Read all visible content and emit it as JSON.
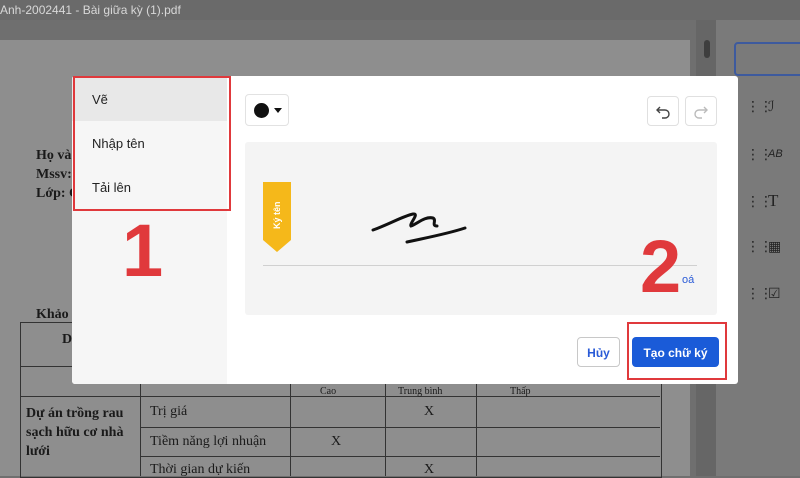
{
  "window": {
    "title": "Anh-2002441 - Bài giữa kỳ (1).pdf"
  },
  "document": {
    "info_lines": [
      "Họ và",
      "Mssv:",
      "Lớp: C"
    ],
    "section_label": "Khảo",
    "table": {
      "header_first": "D",
      "header_cols": [
        "Cao",
        "Trung bình",
        "Thấp"
      ],
      "row_group": "Dự án trồng rau sạch hữu cơ nhà lưới",
      "rows": [
        {
          "criterion": "Trị giá",
          "mark": "X",
          "col": 1
        },
        {
          "criterion": "Tiềm năng lợi nhuận",
          "mark": "X",
          "col": 0
        },
        {
          "criterion": "Thời gian dự kiến",
          "mark": "X",
          "col": 1
        }
      ]
    }
  },
  "right_panel": {
    "icons": [
      "signature-icon",
      "initials-icon",
      "text-icon",
      "calendar-icon",
      "checkbox-icon"
    ],
    "labels": [
      "ℐ",
      "AB",
      "T",
      "▦",
      "☑"
    ]
  },
  "modal": {
    "tabs": [
      {
        "label": "Vẽ",
        "active": true
      },
      {
        "label": "Nhập tên",
        "active": false
      },
      {
        "label": "Tải lên",
        "active": false
      }
    ],
    "pen_color": "#111111",
    "sign_tag_label": "Ký tên",
    "clear_label": "oá",
    "cancel_label": "Hủy",
    "create_label": "Tạo chữ ký"
  },
  "annotations": {
    "step1": "1",
    "step2": "2",
    "color": "#e0393c"
  },
  "colors": {
    "primary": "#1a5bd8",
    "tag": "#f5b81a"
  }
}
